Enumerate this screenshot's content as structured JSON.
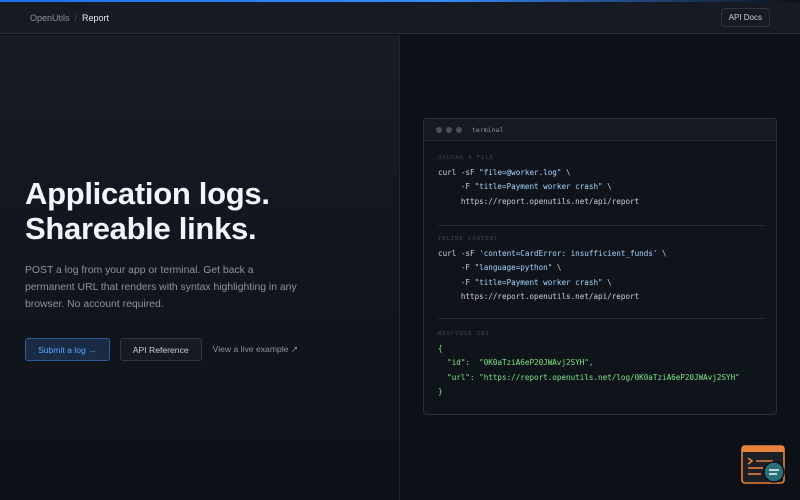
{
  "header": {
    "brand": "OpenUtils",
    "separator": "/",
    "page": "Report",
    "docs_button": "API Docs"
  },
  "hero": {
    "title_line1": "Application logs.",
    "title_line2": "Shareable links.",
    "description": "POST a log from your app or terminal. Get back a permanent URL that renders with syntax highlighting in any browser. No account required.",
    "primary_button": "Submit a log →",
    "secondary_button": "API Reference",
    "live_link": "View a live example ↗"
  },
  "terminal": {
    "title": "terminal",
    "upload": {
      "label": "UPLOAD A FILE",
      "cmd": "curl -sF ",
      "file_arg": "\"file=@worker.log\"",
      "cont1": " \\",
      "title_flag": "     -F ",
      "title_arg": "\"title=Payment worker crash\"",
      "cont2": " \\",
      "url": "     https://report.openutils.net/api/report"
    },
    "inline": {
      "label": "INLINE CONTENT",
      "cmd": "curl -sF ",
      "content_arg": "'content=CardError: insufficient_funds'",
      "cont1": " \\",
      "lang_flag": "     -F ",
      "lang_arg": "\"language=python\"",
      "cont2": " \\",
      "title_flag": "     -F ",
      "title_arg": "\"title=Payment worker crash\"",
      "cont3": " \\",
      "url": "     https://report.openutils.net/api/report"
    },
    "response": {
      "label": "RESPONSE 201",
      "open": "{",
      "id_key": "  \"id\":",
      "id_val": "  \"0K0aTziA6eP20JWAvj2SYH\",",
      "url_key": "  \"url\":",
      "url_val": " \"https://report.openutils.net/log/0K0aTziA6eP20JWAvj2SYH\"",
      "close": "}"
    }
  },
  "colors": {
    "accent": "#58a6ff",
    "fab_orange": "#e8823a",
    "fab_teal": "#2b6f7a"
  },
  "icons": {
    "fab": "log-report-icon"
  }
}
